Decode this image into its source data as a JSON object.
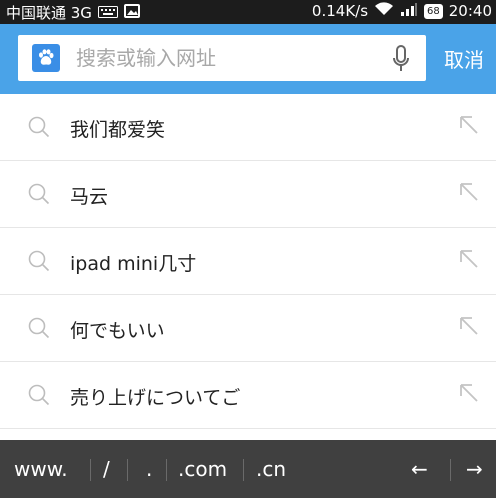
{
  "status_bar": {
    "carrier": "中国联通 3G",
    "speed": "0.14K/s",
    "battery": "68",
    "time": "20:40"
  },
  "search": {
    "placeholder": "搜索或输入网址",
    "cancel_label": "取消"
  },
  "suggestions": [
    {
      "label": "我们都爱笑"
    },
    {
      "label": "马云"
    },
    {
      "label": "ipad mini几寸"
    },
    {
      "label": "何でもいい"
    },
    {
      "label": "売り上げについてご"
    }
  ],
  "url_shortcuts": {
    "www": "www.",
    "slash": "/",
    "dot": ".",
    "com": ".com",
    "cn": ".cn",
    "left": "←",
    "right": "→"
  },
  "colors": {
    "accent": "#4aa3e8",
    "status_bar": "#1c1c1c",
    "bottom_bar": "#404040"
  }
}
